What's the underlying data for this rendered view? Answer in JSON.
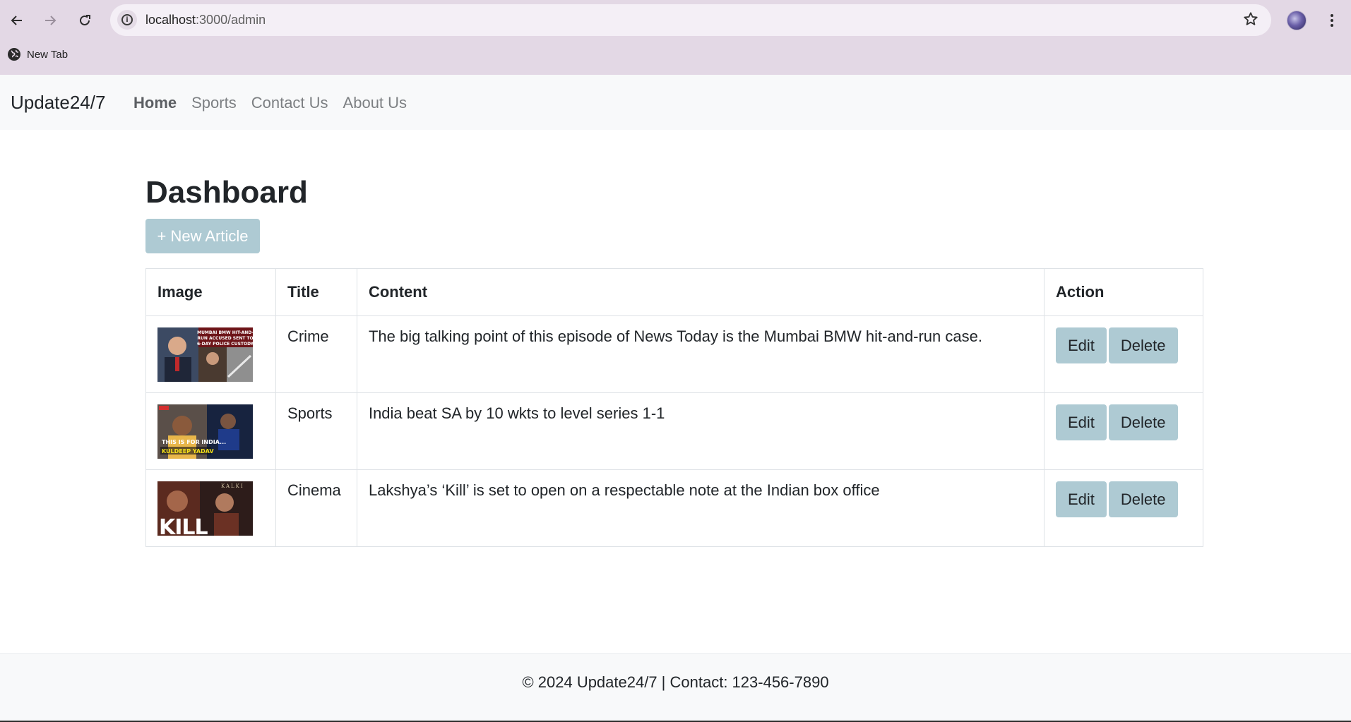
{
  "browser": {
    "url_host": "localhost",
    "url_path": ":3000/admin",
    "bookmark_label": "New Tab"
  },
  "navbar": {
    "brand": "Update24/7",
    "links": [
      {
        "label": "Home",
        "active": true
      },
      {
        "label": "Sports",
        "active": false
      },
      {
        "label": "Contact Us",
        "active": false
      },
      {
        "label": "About Us",
        "active": false
      }
    ]
  },
  "main": {
    "title": "Dashboard",
    "new_article_label": "+ New Article",
    "table": {
      "headers": [
        "Image",
        "Title",
        "Content",
        "Action"
      ],
      "rows": [
        {
          "title": "Crime",
          "content": "The big talking point of this episode of News Today is the Mumbai BMW hit-and-run case.",
          "edit_label": "Edit",
          "delete_label": "Delete",
          "thumb_caption": "MUMBAI BMW HIT-AND-RUN ACCUSED SENT TO 6-DAY POLICE CUSTODY"
        },
        {
          "title": "Sports",
          "content": "India beat SA by 10 wkts to level series 1-1",
          "edit_label": "Edit",
          "delete_label": "Delete",
          "thumb_caption": "THIS IS FOR INDIA... KULDEEP YADAV"
        },
        {
          "title": "Cinema",
          "content": "Lakshya’s ‘Kill’ is set to open on a respectable note at the Indian box office",
          "edit_label": "Edit",
          "delete_label": "Delete",
          "thumb_caption": "KILL"
        }
      ]
    }
  },
  "footer": {
    "text": "© 2024 Update24/7 | Contact: 123-456-7890"
  },
  "colors": {
    "browser_frame": "#e3d8e5",
    "navbar_bg": "#f8f9fa",
    "button_bg": "#aecad3",
    "text": "#212529"
  }
}
